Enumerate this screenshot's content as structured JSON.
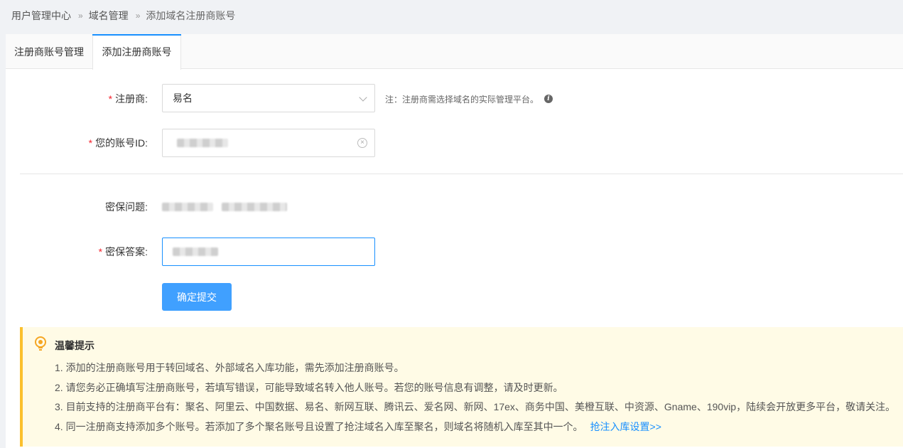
{
  "breadcrumb": {
    "item1": "用户管理中心",
    "item2": "域名管理",
    "item3": "添加域名注册商账号",
    "separator": "»"
  },
  "tabs": {
    "tab1": "注册商账号管理",
    "tab2": "添加注册商账号"
  },
  "form": {
    "registrar_label": "注册商:",
    "registrar_value": "易名",
    "registrar_note": "注：注册商需选择域名的实际管理平台。",
    "account_label": "您的账号ID:",
    "security_question_label": "密保问题:",
    "security_answer_label": "密保答案:",
    "required_mark": "*",
    "submit_label": "确定提交"
  },
  "tips": {
    "title": "温馨提示",
    "line1": "1. 添加的注册商账号用于转回域名、外部域名入库功能，需先添加注册商账号。",
    "line2": "2. 请您务必正确填写注册商账号，若填写错误，可能导致域名转入他人账号。若您的账号信息有调整，请及时更新。",
    "line3": "3. 目前支持的注册商平台有：聚名、阿里云、中国数据、易名、新网互联、腾讯云、爱名网、新网、17ex、商务中国、美橙互联、中资源、Gname、190vip，陆续会开放更多平台，敬请关注。",
    "line4": "4. 同一注册商支持添加多个账号。若添加了多个聚名账号且设置了抢注域名入库至聚名，则域名将随机入库至其中一个。",
    "link": "抢注入库设置>>"
  },
  "colors": {
    "accent": "#1890ff",
    "button": "#40a0ff",
    "required": "#f5222d",
    "tips_bg": "#fffbe6",
    "tips_border": "#fbc02d"
  }
}
